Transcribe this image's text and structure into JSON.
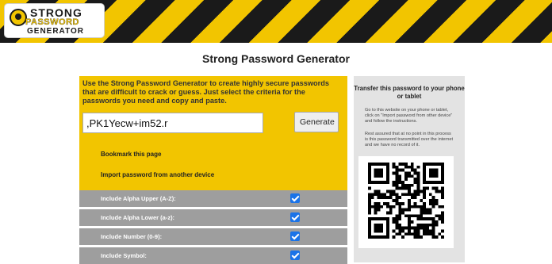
{
  "logo": {
    "line1": "STRONG",
    "line2": "PASSWORD",
    "line3": "GENERATOR"
  },
  "page": {
    "title": "Strong Password Generator"
  },
  "intro": {
    "text": "Use the Strong Password Generator to create highly secure passwords that are difficult to crack or guess. Just select the criteria for the passwords you need and copy and paste."
  },
  "generator": {
    "password": ",PK1Yecw+im52.r",
    "button": "Generate"
  },
  "links": {
    "bookmark": "Bookmark this page",
    "import": "Import password from another device"
  },
  "options": [
    {
      "label": "Include Alpha Upper (A-Z):",
      "checked": true
    },
    {
      "label": "Include Alpha Lower (a-z):",
      "checked": true
    },
    {
      "label": "Include Number (0-9):",
      "checked": true
    },
    {
      "label": "Include Symbol:",
      "checked": true
    }
  ],
  "side": {
    "title": "Transfer this password to your phone or tablet",
    "p1": "Go to this website on your phone or tablet, click on \"Import password from other device\" and follow the instructions.",
    "p2": "Rest assured that at no point in this process is this password transmitted over the internet and we have no record of it."
  },
  "colors": {
    "accent": "#f2c500",
    "dark": "#1a1a1a",
    "row": "#9e9e9e",
    "check": "#1a73e8"
  }
}
